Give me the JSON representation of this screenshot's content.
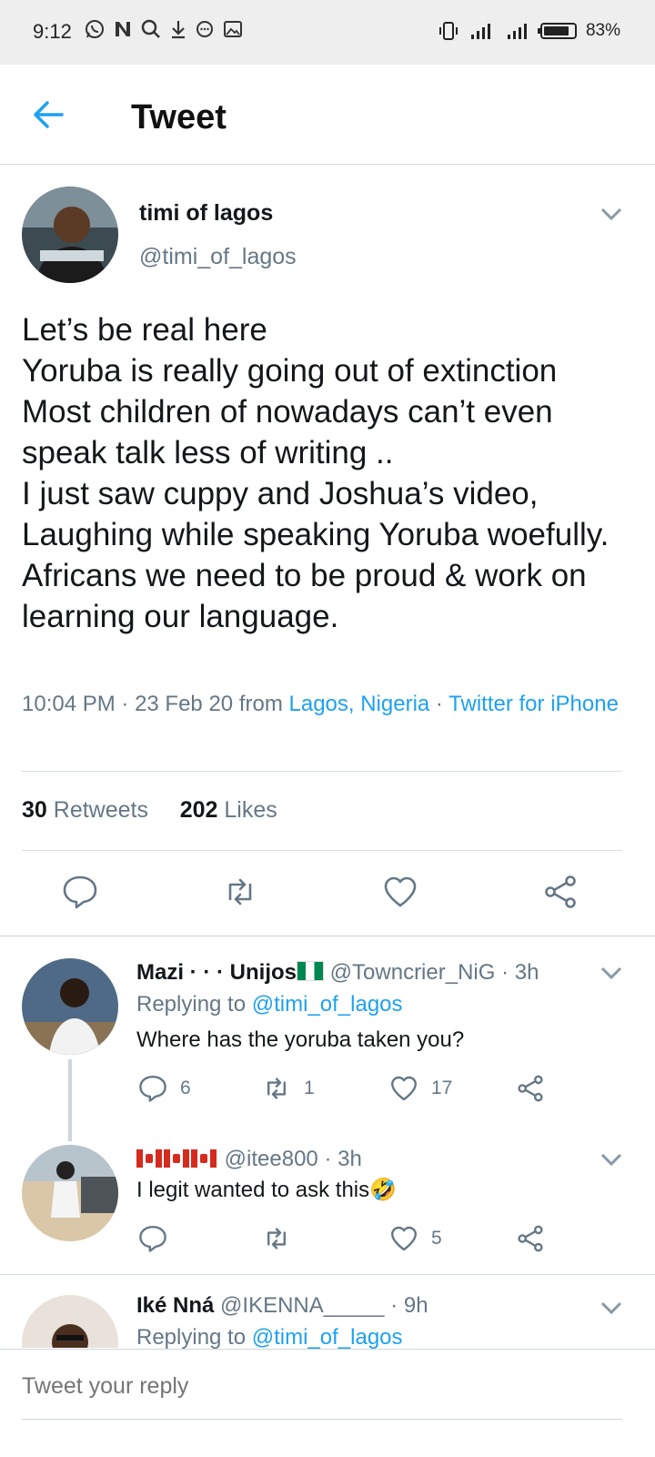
{
  "status_bar": {
    "time": "9:12",
    "left_icons": [
      "whatsapp-icon",
      "n-icon",
      "search-icon",
      "download-icon",
      "chat-icon",
      "image-icon"
    ],
    "battery_percent": "83%",
    "battery_level": 0.83
  },
  "header": {
    "title": "Tweet"
  },
  "tweet": {
    "author_name": "timi of lagos",
    "author_handle": "@timi_of_lagos",
    "text": "Let’s be real here\nYoruba is really going out of extinction\nMost children of nowadays can’t even speak talk less of writing ..\nI just saw cuppy and Joshua’s video, Laughing while speaking Yoruba woefully.\nAfricans we need to be proud & work on learning our language.",
    "time": "10:04 PM",
    "date": "23 Feb 20",
    "from_label": "from",
    "location": "Lagos, Nigeria",
    "source": "Twitter for iPhone",
    "retweets_count": "30",
    "retweets_label": "Retweets",
    "likes_count": "202",
    "likes_label": "Likes"
  },
  "replies": [
    {
      "name": "Mazi · · · Unijos",
      "handle": "@Towncrier_NiG",
      "time": "3h",
      "replying_label": "Replying to",
      "replying_to": "@timi_of_lagos",
      "text": "Where has the yoruba taken you?",
      "reply_count": "6",
      "retweet_count": "1",
      "like_count": "17"
    },
    {
      "name": "",
      "handle": "@itee800",
      "time": "3h",
      "text": "I legit wanted to ask this🤣",
      "reply_count": "",
      "retweet_count": "",
      "like_count": "5"
    },
    {
      "name": "Iké Nná",
      "handle": "@IKENNA_____",
      "time": "9h",
      "replying_label": "Replying to",
      "replying_to": "@timi_of_lagos"
    }
  ],
  "reply_box": {
    "placeholder": "Tweet your reply"
  },
  "colors": {
    "accent": "#1da1f2",
    "muted": "#657786",
    "text": "#14171a"
  }
}
